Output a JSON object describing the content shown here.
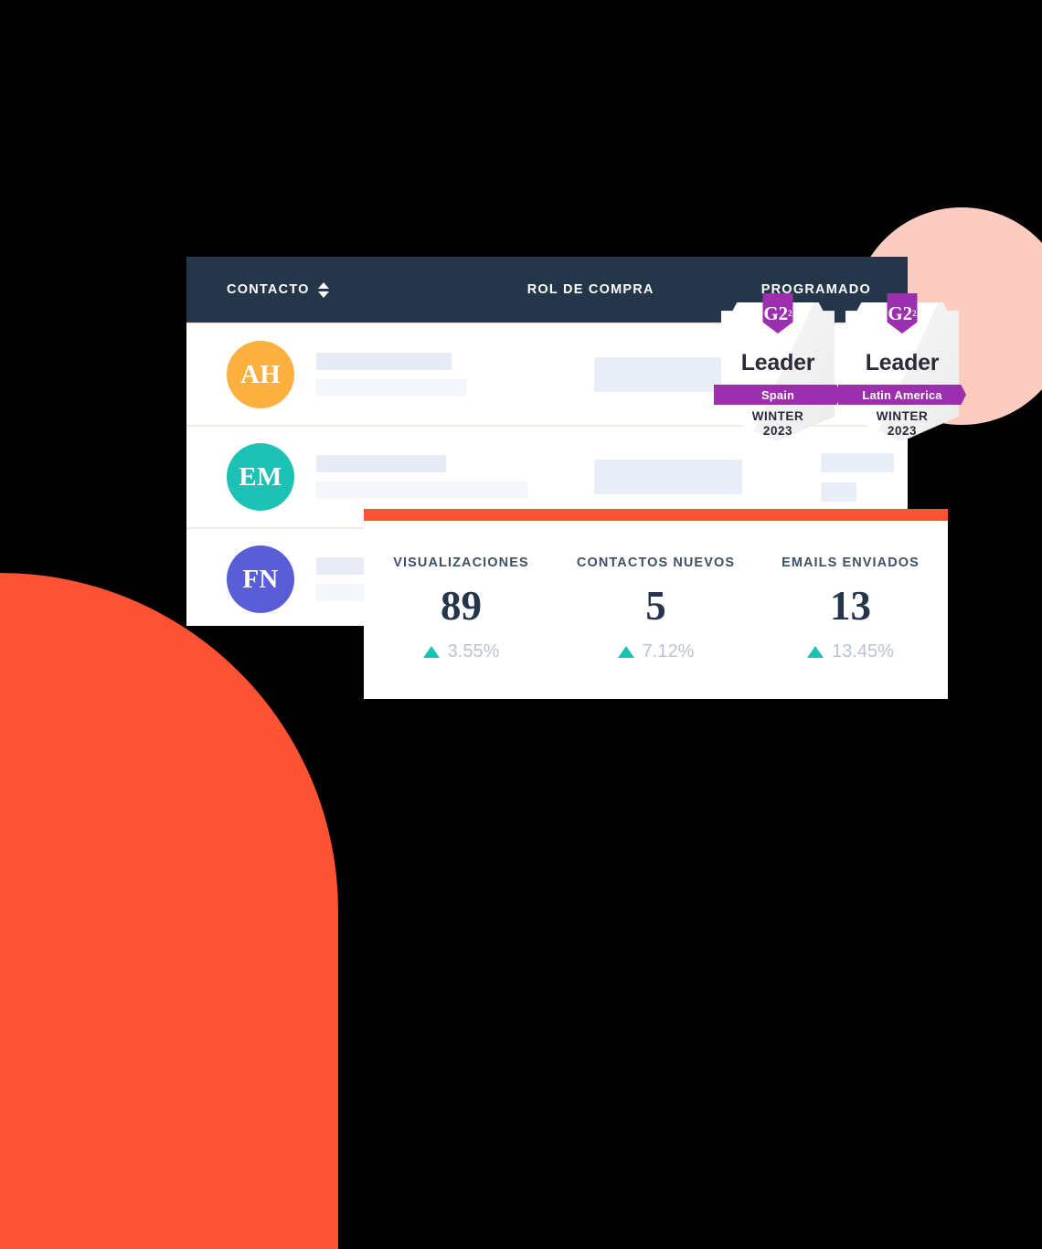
{
  "table": {
    "columns": [
      {
        "label": "CONTACTO",
        "sort_icon": "sort-updown-icon"
      },
      {
        "label": "ROL DE COMPRA"
      },
      {
        "label": "PROGRAMADO"
      }
    ],
    "rows": [
      {
        "avatar_initials": "AH",
        "avatar_color": "#f9b council"
      },
      {
        "avatar_initials": "EM",
        "avatar_color": "#17c3b2"
      },
      {
        "avatar_initials": "FN",
        "avatar_color": "#5a5ed6"
      }
    ]
  },
  "rows": [
    {
      "initials": "AH",
      "color": "#fbb040"
    },
    {
      "initials": "EM",
      "color": "#1ec2b4"
    },
    {
      "initials": "FN",
      "color": "#5a5ed6"
    }
  ],
  "badges": [
    {
      "logo": "G2",
      "logo_sup": "2",
      "title": "Leader",
      "region": "Spain",
      "season": "WINTER",
      "year": "2023"
    },
    {
      "logo": "G2",
      "logo_sup": "2",
      "title": "Leader",
      "region": "Latin America",
      "season": "WINTER",
      "year": "2023"
    }
  ],
  "stats": [
    {
      "label": "VISUALIZACIONES",
      "value": "89",
      "delta": "3.55%",
      "trend_icon": "triangle-up-icon"
    },
    {
      "label": "CONTACTOS NUEVOS",
      "value": "5",
      "delta": "7.12%",
      "trend_icon": "triangle-up-icon"
    },
    {
      "label": "EMAILS ENVIADOS",
      "value": "13",
      "delta": "13.45%",
      "trend_icon": "triangle-up-icon"
    }
  ],
  "colors": {
    "header_bg": "#26364a",
    "accent_orange": "#fb5333",
    "accent_pink": "#fbccbf",
    "accent_teal": "#17c3b2",
    "badge_purple": "#9b2fae",
    "row_divider": "#fbe8dc"
  }
}
